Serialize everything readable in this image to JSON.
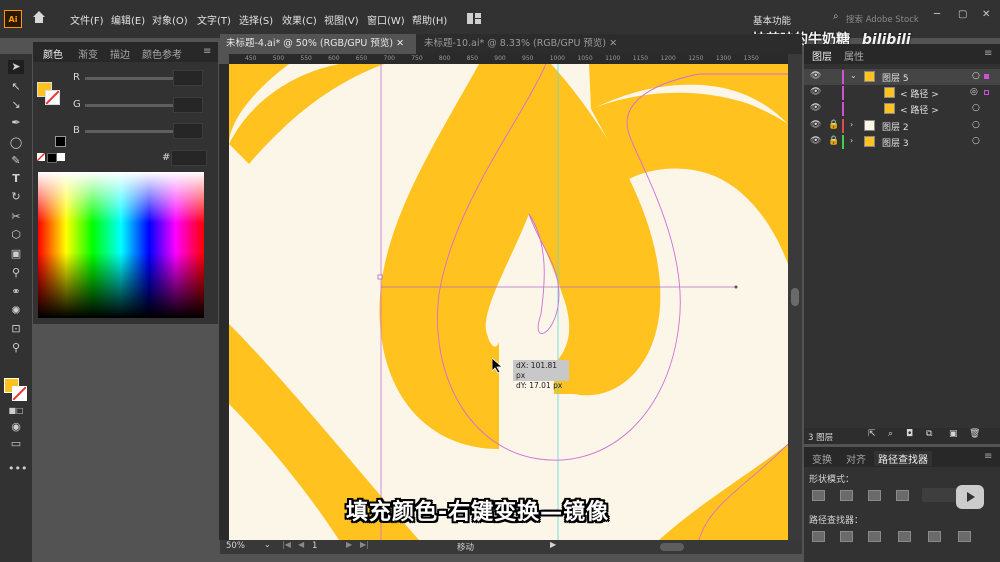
{
  "app": {
    "logo": "Ai"
  },
  "menu": [
    "文件(F)",
    "编辑(E)",
    "对象(O)",
    "文字(T)",
    "选择(S)",
    "效果(C)",
    "视图(V)",
    "窗口(W)",
    "帮助(H)"
  ],
  "workspace": "基本功能",
  "search_placeholder": "搜索 Adobe Stock",
  "watermark": "抹茶味的牛奶糖_",
  "watermark_brand": "bilibili",
  "color_panel": {
    "tabs": [
      "颜色",
      "渐变",
      "描边",
      "颜色参考"
    ],
    "channels": [
      "R",
      "G",
      "B"
    ],
    "hex_label": "#"
  },
  "doc_tabs": [
    {
      "label": "未标题-4.ai* @ 50% (RGB/GPU 预览)",
      "active": true
    },
    {
      "label": "未标题-10.ai* @ 8.33% (RGB/GPU 预览)",
      "active": false
    }
  ],
  "ruler_ticks": [
    "450",
    "500",
    "550",
    "600",
    "650",
    "700",
    "750",
    "800",
    "850",
    "900",
    "950",
    "1000",
    "1050",
    "1100",
    "1150",
    "1200",
    "1250",
    "1300",
    "1350"
  ],
  "tooltip": {
    "dx": "dX: 101.81 px",
    "dy": "dY: 17.01 px"
  },
  "status": {
    "zoom": "50%",
    "page": "1",
    "tool": "移动"
  },
  "layers_panel": {
    "tabs": [
      "图层",
      "属性"
    ],
    "layers": [
      {
        "name": "图层 5",
        "color": "#d34fd3",
        "expanded": true
      },
      {
        "name": "< 路径 >",
        "color": "#d34fd3",
        "child": true
      },
      {
        "name": "< 路径 >",
        "color": "#d34fd3",
        "child": true
      },
      {
        "name": "图层 2",
        "color": "#e04a4a"
      },
      {
        "name": "图层 3",
        "color": "#3ecf4c"
      }
    ],
    "count": "3 图层"
  },
  "pathfinder": {
    "tabs": [
      "变换",
      "对齐",
      "路径查找器"
    ],
    "shape_modes_label": "形状模式：",
    "pathfinders_label": "路径查找器："
  },
  "subtitle": "填充颜色-右键变换—镜像",
  "colors": {
    "fill": "#ffc21e",
    "background": "#fbf6e8",
    "guide": "#cf6fd8",
    "accent": "#ffc21e"
  }
}
